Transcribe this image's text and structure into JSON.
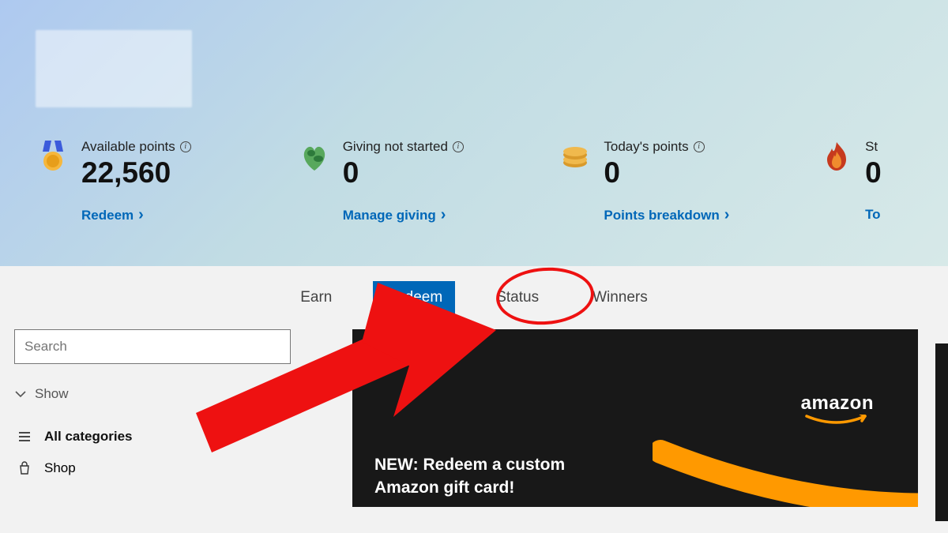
{
  "hero": {
    "stats": [
      {
        "icon": "medal",
        "label": "Available points",
        "value": "22,560",
        "link": "Redeem"
      },
      {
        "icon": "earth-heart",
        "label": "Giving not started",
        "value": "0",
        "link": "Manage giving"
      },
      {
        "icon": "coins",
        "label": "Today's points",
        "value": "0",
        "link": "Points breakdown"
      },
      {
        "icon": "flame",
        "label": "St",
        "value": "0",
        "link": "To"
      }
    ]
  },
  "tabs": {
    "items": [
      "Earn",
      "Redeem",
      "Status",
      "Winners"
    ],
    "active_index": 1
  },
  "search": {
    "placeholder": "Search"
  },
  "show_label": "Show",
  "categories": [
    {
      "icon": "list",
      "label": "All categories",
      "bold": true
    },
    {
      "icon": "bag",
      "label": "Shop",
      "bold": false
    }
  ],
  "card": {
    "headline_line1": "NEW: Redeem a custom",
    "headline_line2": "Amazon gift card!",
    "brand": "amazon"
  },
  "colors": {
    "link_blue": "#0067b8",
    "anno_red": "#e11",
    "amazon_orange": "#ff9900"
  }
}
